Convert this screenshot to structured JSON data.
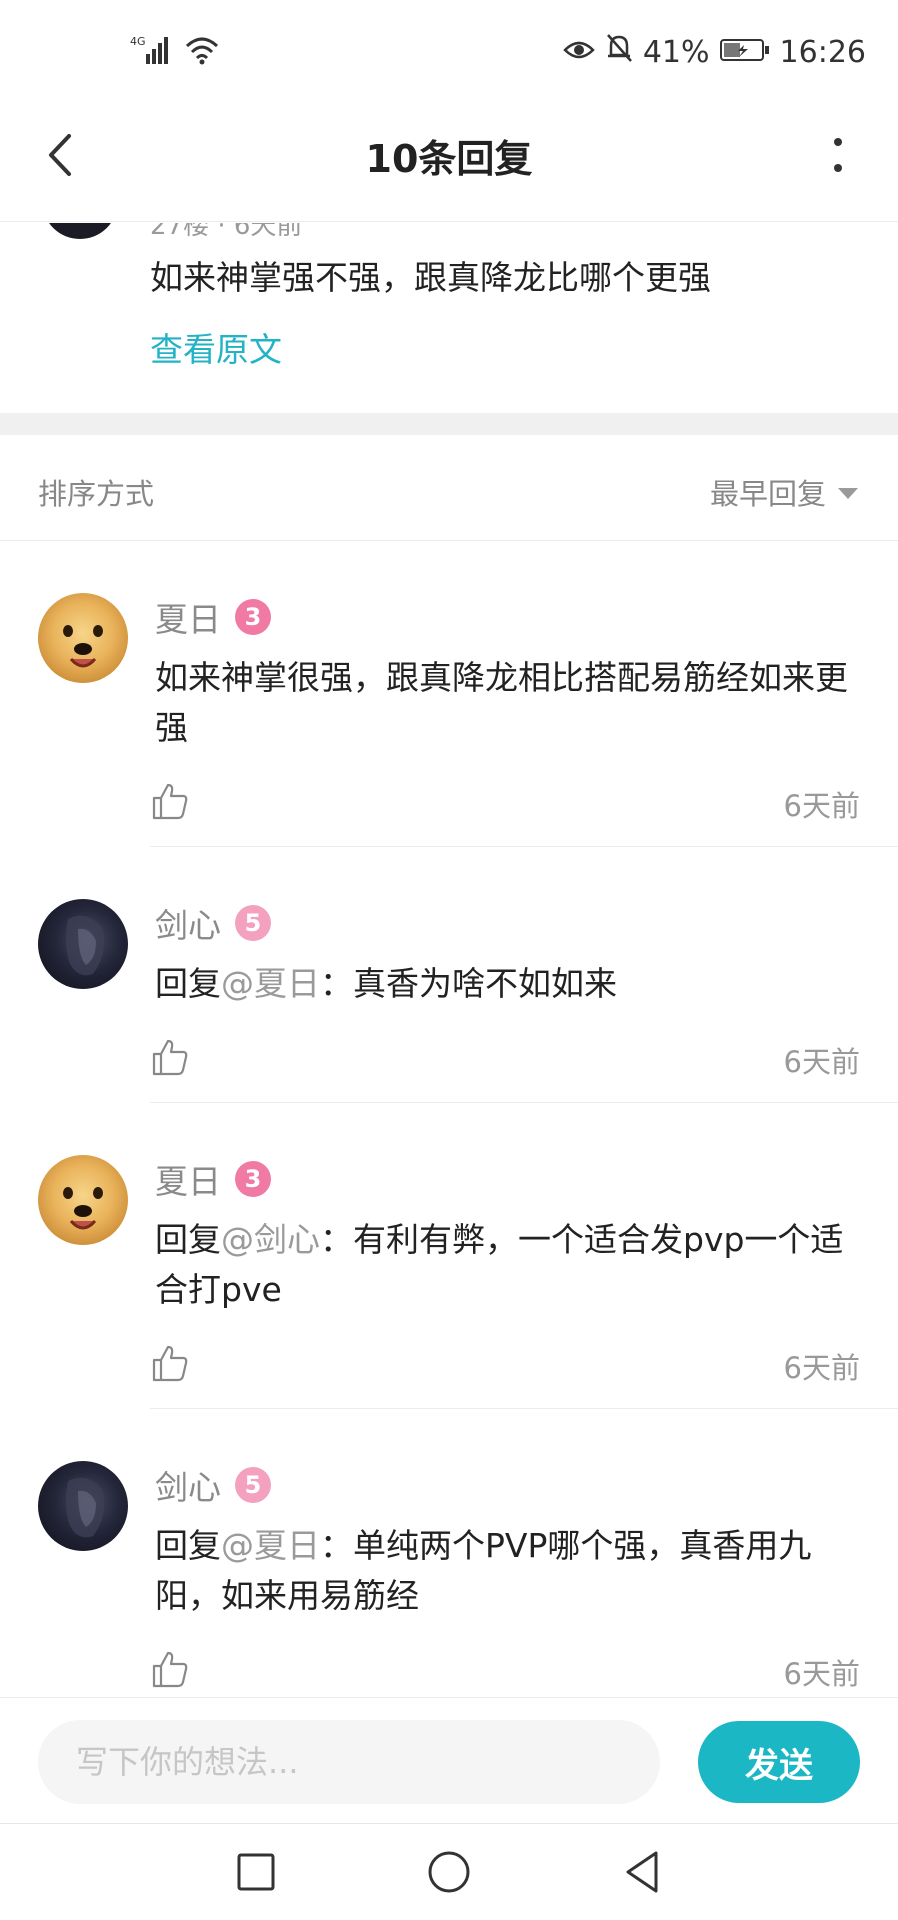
{
  "status_bar": {
    "network": "4G",
    "battery_percent": "41%",
    "time": "16:26",
    "icons": [
      "signal-icon",
      "wifi-icon",
      "eye-icon",
      "mute-bell-icon",
      "battery-icon"
    ]
  },
  "header": {
    "title": "10条回复",
    "back_icon": "chevron-left-icon",
    "more_icon": "more-vertical-icon"
  },
  "original_post": {
    "meta": "27楼 · 6天前",
    "text": "如来神掌强不强，跟真降龙比哪个更强",
    "view_original_label": "查看原文"
  },
  "sort": {
    "label": "排序方式",
    "value": "最早回复"
  },
  "comments": [
    {
      "name": "夏日",
      "level": "3",
      "reply_prefix": "",
      "mention": "",
      "text": "如来神掌很强，跟真降龙相比搭配易筋经如来更强",
      "time": "6天前"
    },
    {
      "name": "剑心",
      "level": "5",
      "reply_prefix": "回复",
      "mention": "@夏日",
      "text": "：真香为啥不如如来",
      "time": "6天前"
    },
    {
      "name": "夏日",
      "level": "3",
      "reply_prefix": "回复",
      "mention": "@剑心",
      "text": "：有利有弊，一个适合发pvp一个适合打pve",
      "time": "6天前"
    },
    {
      "name": "剑心",
      "level": "5",
      "reply_prefix": "回复",
      "mention": "@夏日",
      "text": "：单纯两个PVP哪个强，真香用九阳，如来用易筋经",
      "time": "6天前"
    }
  ],
  "input_bar": {
    "placeholder": "写下你的想法...",
    "send_label": "发送"
  },
  "colors": {
    "accent": "#1cb7c4",
    "link": "#22b3c6",
    "level_badge": "#f07aa3"
  }
}
